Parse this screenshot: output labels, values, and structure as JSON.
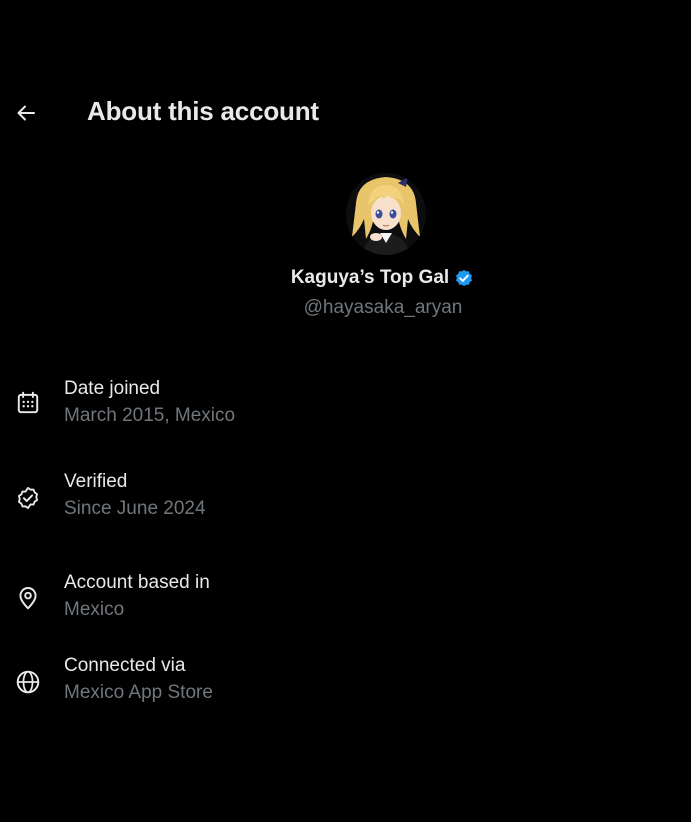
{
  "header": {
    "title": "About this account",
    "back_icon": "arrow-left-icon"
  },
  "profile": {
    "display_name": "Kaguya’s Top Gal",
    "handle": "@hayasaka_aryan",
    "verified": true,
    "verified_color": "#1d9bf0",
    "avatar_icon": "avatar"
  },
  "details": [
    {
      "icon": "calendar-icon",
      "label": "Date joined",
      "value": "March 2015, Mexico"
    },
    {
      "icon": "verified-check-icon",
      "label": "Verified",
      "value": "Since June 2024"
    },
    {
      "icon": "location-pin-icon",
      "label": "Account based in",
      "value": "Mexico"
    },
    {
      "icon": "globe-icon",
      "label": "Connected via",
      "value": "Mexico App Store"
    }
  ],
  "colors": {
    "background": "#000000",
    "primary_text": "#e7e9ea",
    "secondary_text": "#71767b"
  }
}
